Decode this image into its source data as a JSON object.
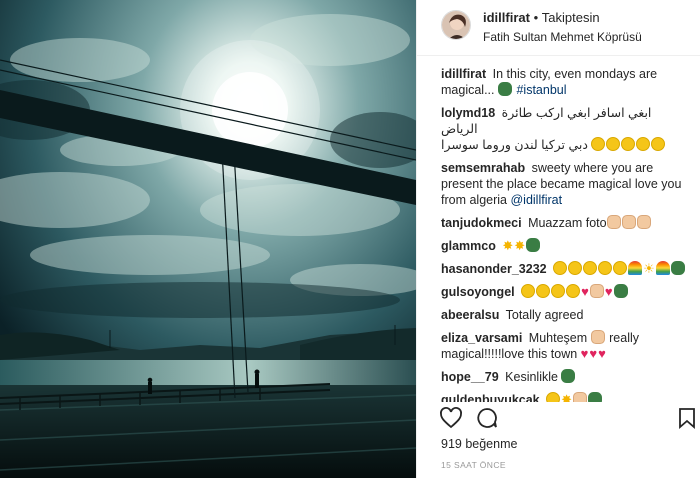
{
  "post": {
    "author": "idillfirat",
    "separator": "•",
    "follow_label": "Takiptesin",
    "location": "Fatih Sultan Mehmet Köprüsü",
    "photo_icon": "bridge-sunset-photo",
    "avatar_icon": "profile-avatar"
  },
  "comments": [
    {
      "user": "idillfirat",
      "text": "In this city, even mondays are magical...",
      "emojis": [
        "green-eye"
      ],
      "tag": "#istanbul"
    },
    {
      "user": "lolymd18",
      "text": "ابغي اسافر ابغي اركب طائرة الرياض ",
      "text2": "دبي تركيا لندن وروما سوسرا",
      "emojis": [
        "crying-face",
        "crying-face",
        "crying-face",
        "crying-face",
        "crying-face"
      ]
    },
    {
      "user": "semsemrahab",
      "text": "sweety where you are present the place became magical love you from algeria",
      "tag": "@idillfirat"
    },
    {
      "user": "tanjudokmeci",
      "text": "Muazzam foto",
      "emojis": [
        "ok-hand",
        "thumbs-up",
        "clap"
      ]
    },
    {
      "user": "glammco",
      "text": "",
      "emojis": [
        "sparkles",
        "sparkles",
        "green-eye"
      ]
    },
    {
      "user": "hasanonder_3232",
      "text": "",
      "emojis": [
        "smile",
        "smile",
        "smile",
        "smile",
        "smile",
        "rainbow",
        "sun",
        "rainbow",
        "tree"
      ]
    },
    {
      "user": "gulsoyongel",
      "text": "",
      "emojis": [
        "clap",
        "clap",
        "clap",
        "clap",
        "heart",
        "couple",
        "heart",
        "tree"
      ]
    },
    {
      "user": "abeeralsu",
      "text": "Totally agreed"
    },
    {
      "user": "eliza_varsami",
      "text": "Muhteşem",
      "emojis": [
        "bridge"
      ],
      "text_after": "really magical!!!!!love this town",
      "emojis_after": [
        "heart",
        "heart",
        "heart"
      ]
    },
    {
      "user": "hope__79",
      "text": "Kesinlikle",
      "emojis": [
        "green-eye"
      ]
    },
    {
      "user": "guldenbuyukcak",
      "text": "",
      "emojis": [
        "heart-eyes",
        "sparkles",
        "ok-hand",
        "green-eye"
      ]
    }
  ],
  "actions": {
    "like_icon": "heart-icon",
    "comment_icon": "comment-icon",
    "save_icon": "bookmark-icon"
  },
  "likes": "919 beğenme",
  "time": "15 SAAT ÖNCE"
}
